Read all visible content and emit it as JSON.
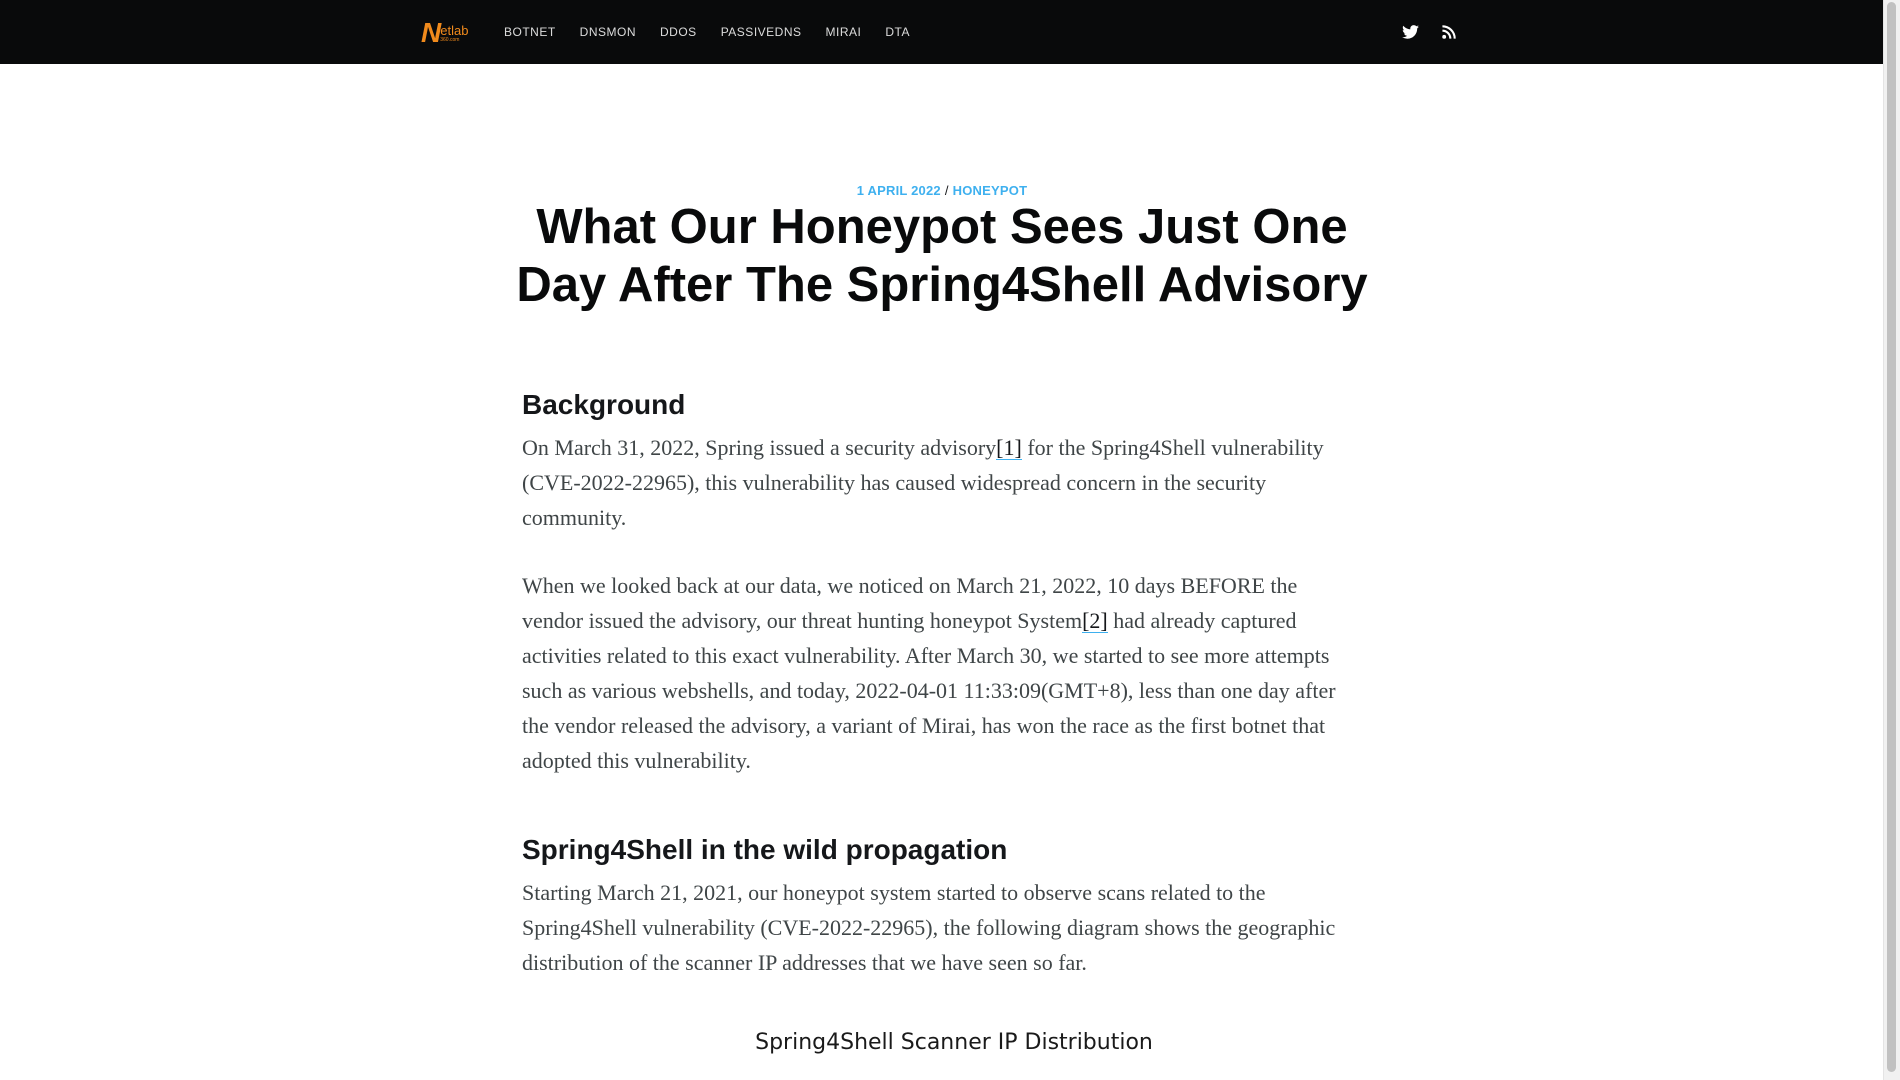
{
  "logo": {
    "mark": "N",
    "wordmark": "etlab",
    "subtext": "360.com"
  },
  "nav": {
    "links": [
      "BOTNET",
      "DNSMON",
      "DDOS",
      "PASSIVEDNS",
      "MIRAI",
      "DTA"
    ],
    "social": [
      "twitter-icon",
      "rss-icon"
    ]
  },
  "post": {
    "date": "1 APRIL 2022",
    "separator": "/",
    "tag": "HONEYPOT",
    "title": "What Our Honeypot Sees Just One Day After The Spring4Shell Advisory"
  },
  "sections": {
    "background": {
      "heading": "Background",
      "p1": {
        "before": "On March 31, 2022, Spring issued a security advisory",
        "ref": "[1]",
        "after": " for the Spring4Shell vulnerability (CVE-2022-22965), this vulnerability has caused widespread concern in the security community."
      },
      "p2": {
        "before": "When we looked back at our data, we noticed on March 21, 2022, 10 days BEFORE the vendor issued the advisory, our threat hunting honeypot System",
        "ref": "[2]",
        "after": " had already captured activities related to this exact vulnerability. After March 30, we started to see more attempts such as various webshells, and today, 2022-04-01 11:33:09(GMT+8), less than one day after the vendor released the advisory, a variant of Mirai, has won the race as the first botnet that adopted this vulnerability."
      }
    },
    "propagation": {
      "heading": "Spring4Shell in the wild propagation",
      "p1": "Starting March 21, 2021, our honeypot system started to observe scans related to the Spring4Shell vulnerability (CVE-2022-22965), the following diagram shows the geographic distribution of the scanner IP addresses that we have seen so far."
    }
  },
  "figure": {
    "title": "Spring4Shell Scanner IP Distribution"
  },
  "colors": {
    "nav_bg": "#090a0b",
    "accent": "#3eb0ef",
    "logo": "#f08a1c"
  }
}
